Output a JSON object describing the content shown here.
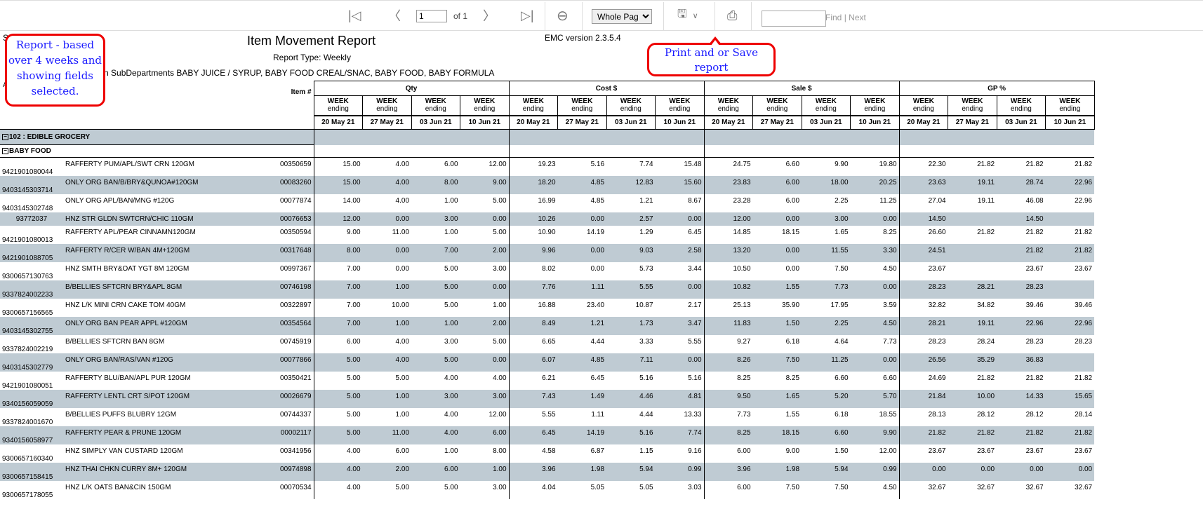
{
  "toolbar": {
    "page": "1",
    "of_label": "of 1",
    "zoom": "Whole Page",
    "find_label": "Find",
    "separator": "|",
    "next_label": "Next",
    "find_value": ""
  },
  "report": {
    "title": "Item Movement Report",
    "version": "EMC version 2.3.5.4",
    "type": "Report Type: Weekly",
    "filter": "ter: Is in SubDepartments BABY JUICE / SYRUP, BABY FOOD CREAL/SNAC, BABY FOOD, BABY FORMULA",
    "s_fragment": "S",
    "a_fragment": "A"
  },
  "callouts": {
    "left": "Report - based over 4 weeks and showing fields selected.",
    "right": "Print and or Save report"
  },
  "table": {
    "item_header": "Item #",
    "groups": [
      "Qty",
      "Cost $",
      "Sale $",
      "GP %"
    ],
    "week_label_1": "WEEK",
    "week_label_2": "ending",
    "weeks": [
      "20 May 21",
      "27 May 21",
      "03 Jun 21",
      "10 Jun 21"
    ],
    "department": "102 : EDIBLE GROCERY",
    "subdepartment": "BABY FOOD",
    "rows": [
      [
        "9421901080044",
        "RAFFERTY PUM/APL/SWT CRN 120GM",
        "00350659",
        "15.00",
        "4.00",
        "6.00",
        "12.00",
        "19.23",
        "5.16",
        "7.74",
        "15.48",
        "24.75",
        "6.60",
        "9.90",
        "19.80",
        "22.30",
        "21.82",
        "21.82",
        "21.82"
      ],
      [
        "9403145303714",
        "ONLY ORG BAN/B/BRY&QUNOA#120GM",
        "00083260",
        "15.00",
        "4.00",
        "8.00",
        "9.00",
        "18.20",
        "4.85",
        "12.83",
        "15.60",
        "23.83",
        "6.00",
        "18.00",
        "20.25",
        "23.63",
        "19.11",
        "28.74",
        "22.96"
      ],
      [
        "9403145302748",
        "ONLY ORG APL/BAN/MNG     #120G",
        "00077874",
        "14.00",
        "4.00",
        "1.00",
        "5.00",
        "16.99",
        "4.85",
        "1.21",
        "8.67",
        "23.28",
        "6.00",
        "2.25",
        "11.25",
        "27.04",
        "19.11",
        "46.08",
        "22.96"
      ],
      [
        "93772037",
        "HNZ STR GLDN SWTCRN/CHIC 110GM",
        "00076653",
        "12.00",
        "0.00",
        "3.00",
        "0.00",
        "10.26",
        "0.00",
        "2.57",
        "0.00",
        "12.00",
        "0.00",
        "3.00",
        "0.00",
        "14.50",
        "",
        "14.50",
        ""
      ],
      [
        "9421901080013",
        "RAFFERTY APL/PEAR CINNAMN120GM",
        "00350594",
        "9.00",
        "11.00",
        "1.00",
        "5.00",
        "10.90",
        "14.19",
        "1.29",
        "6.45",
        "14.85",
        "18.15",
        "1.65",
        "8.25",
        "26.60",
        "21.82",
        "21.82",
        "21.82"
      ],
      [
        "9421901088705",
        "RAFFERTY R/CER W/BAN  4M+120GM",
        "00317648",
        "8.00",
        "0.00",
        "7.00",
        "2.00",
        "9.96",
        "0.00",
        "9.03",
        "2.58",
        "13.20",
        "0.00",
        "11.55",
        "3.30",
        "24.51",
        "",
        "21.82",
        "21.82"
      ],
      [
        "9300657130763",
        "HNZ SMTH BRY&OAT YGT 8M  120GM",
        "00997367",
        "7.00",
        "0.00",
        "5.00",
        "3.00",
        "8.02",
        "0.00",
        "5.73",
        "3.44",
        "10.50",
        "0.00",
        "7.50",
        "4.50",
        "23.67",
        "",
        "23.67",
        "23.67"
      ],
      [
        "9337824002233",
        "B/BELLIES SFTCRN BRY&APL   8GM",
        "00746198",
        "7.00",
        "1.00",
        "5.00",
        "0.00",
        "7.76",
        "1.11",
        "5.55",
        "0.00",
        "10.82",
        "1.55",
        "7.73",
        "0.00",
        "28.23",
        "28.21",
        "28.23",
        ""
      ],
      [
        "9300657156565",
        "HNZ L/K MINI CRN CAKE TOM 40GM",
        "00322897",
        "7.00",
        "10.00",
        "5.00",
        "1.00",
        "16.88",
        "23.40",
        "10.87",
        "2.17",
        "25.13",
        "35.90",
        "17.95",
        "3.59",
        "32.82",
        "34.82",
        "39.46",
        "39.46"
      ],
      [
        "9403145302755",
        "ONLY ORG BAN PEAR APPL  #120GM",
        "00354564",
        "7.00",
        "1.00",
        "1.00",
        "2.00",
        "8.49",
        "1.21",
        "1.73",
        "3.47",
        "11.83",
        "1.50",
        "2.25",
        "4.50",
        "28.21",
        "19.11",
        "22.96",
        "22.96"
      ],
      [
        "9337824002219",
        "B/BELLIES SFTCRN BAN      8GM",
        "00745919",
        "6.00",
        "4.00",
        "3.00",
        "5.00",
        "6.65",
        "4.44",
        "3.33",
        "5.55",
        "9.27",
        "6.18",
        "4.64",
        "7.73",
        "28.23",
        "28.24",
        "28.23",
        "28.23"
      ],
      [
        "9403145302779",
        "ONLY ORG BAN/RAS/VAN    #120G",
        "00077866",
        "5.00",
        "4.00",
        "5.00",
        "0.00",
        "6.07",
        "4.85",
        "7.11",
        "0.00",
        "8.26",
        "7.50",
        "11.25",
        "0.00",
        "26.56",
        "35.29",
        "36.83",
        ""
      ],
      [
        "9421901080051",
        "RAFFERTY BLU/BAN/APL PUR 120GM",
        "00350421",
        "5.00",
        "5.00",
        "4.00",
        "4.00",
        "6.21",
        "6.45",
        "5.16",
        "5.16",
        "8.25",
        "8.25",
        "6.60",
        "6.60",
        "24.69",
        "21.82",
        "21.82",
        "21.82"
      ],
      [
        "9340156059059",
        "RAFFERTY LENTL CRT S/POT 120GM",
        "00026679",
        "5.00",
        "1.00",
        "3.00",
        "3.00",
        "7.43",
        "1.49",
        "4.46",
        "4.81",
        "9.50",
        "1.65",
        "5.20",
        "5.70",
        "21.84",
        "10.00",
        "14.33",
        "15.65"
      ],
      [
        "9337824001670",
        "B/BELLIES PUFFS BLUBRY    12GM",
        "00744337",
        "5.00",
        "1.00",
        "4.00",
        "12.00",
        "5.55",
        "1.11",
        "4.44",
        "13.33",
        "7.73",
        "1.55",
        "6.18",
        "18.55",
        "28.13",
        "28.12",
        "28.12",
        "28.14"
      ],
      [
        "9340156058977",
        "RAFFERTY PEAR & PRUNE   120GM",
        "00002117",
        "5.00",
        "11.00",
        "4.00",
        "6.00",
        "6.45",
        "14.19",
        "5.16",
        "7.74",
        "8.25",
        "18.15",
        "6.60",
        "9.90",
        "21.82",
        "21.82",
        "21.82",
        "21.82"
      ],
      [
        "9300657160340",
        "HNZ SIMPLY VAN CUSTARD  120GM",
        "00341956",
        "4.00",
        "6.00",
        "1.00",
        "8.00",
        "4.58",
        "6.87",
        "1.15",
        "9.16",
        "6.00",
        "9.00",
        "1.50",
        "12.00",
        "23.67",
        "23.67",
        "23.67",
        "23.67"
      ],
      [
        "9300657158415",
        "HNZ THAI CHKN CURRY 8M+ 120GM",
        "00974898",
        "4.00",
        "2.00",
        "6.00",
        "1.00",
        "3.96",
        "1.98",
        "5.94",
        "0.99",
        "3.96",
        "1.98",
        "5.94",
        "0.99",
        "0.00",
        "0.00",
        "0.00",
        "0.00"
      ],
      [
        "9300657178055",
        "HNZ L/K OATS BAN&CIN    150GM",
        "00070534",
        "4.00",
        "5.00",
        "5.00",
        "3.00",
        "4.04",
        "5.05",
        "5.05",
        "3.03",
        "6.00",
        "7.50",
        "7.50",
        "4.50",
        "32.67",
        "32.67",
        "32.67",
        "32.67"
      ]
    ]
  },
  "colors": {
    "row_alt": "#bfcbd3",
    "callout_border": "#ee0000",
    "callout_text": "#1a1aff"
  }
}
